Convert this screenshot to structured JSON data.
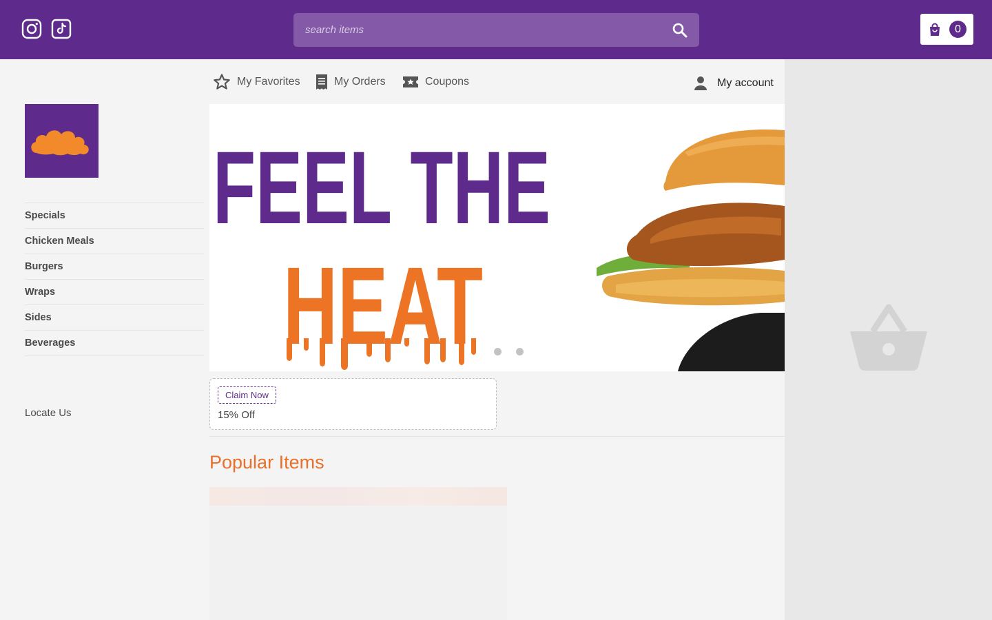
{
  "header": {
    "social": [
      "instagram-icon",
      "tiktok-icon"
    ],
    "search": {
      "placeholder": "search items"
    },
    "cart": {
      "count": "0"
    }
  },
  "nav": {
    "favorites": "My Favorites",
    "orders": "My Orders",
    "coupons": "Coupons",
    "account": "My account"
  },
  "sidebar": {
    "items": [
      {
        "label": "Specials"
      },
      {
        "label": "Chicken Meals"
      },
      {
        "label": "Burgers"
      },
      {
        "label": "Wraps"
      },
      {
        "label": "Sides"
      },
      {
        "label": "Beverages"
      }
    ],
    "locate": "Locate Us"
  },
  "banner": {
    "line1": "FEEL THE",
    "line2": "HEAT",
    "slides": 2
  },
  "coupon": {
    "button": "Claim Now",
    "text": "15% Off"
  },
  "popular": {
    "title": "Popular Items"
  },
  "colors": {
    "brand": "#5e2b8c",
    "accent": "#e8702a"
  }
}
